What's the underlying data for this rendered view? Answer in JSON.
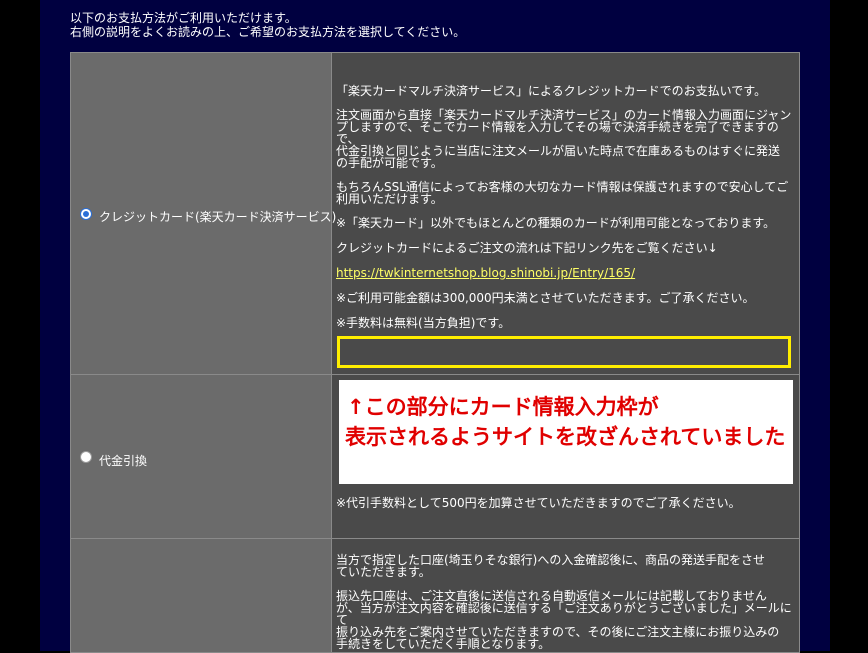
{
  "intro": {
    "line1": "以下のお支払方法がご利用いただけます。",
    "line2": "右側の説明をよくお読みの上、ご希望のお支払方法を選択してください。"
  },
  "options": [
    {
      "label": "クレジットカード(楽天カード決済サービス)",
      "selected": true,
      "desc": {
        "p1": "「楽天カードマルチ決済サービス」によるクレジットカードでのお支払いです。",
        "p2a": "注文画面から直接「楽天カードマルチ決済サービス」のカード情報入力画面にジャン",
        "p2b": "プしますので、そこでカード情報を入力してその場で決済手続きを完了できますので、",
        "p2c": "代金引換と同じように当店に注文メールが届いた時点で在庫あるものはすぐに発送",
        "p2d": "の手配が可能です。",
        "p3a": "もちろんSSL通信によってお客様の大切なカード情報は保護されますので安心してご",
        "p3b": "利用いただけます。",
        "p4": "※「楽天カード」以外でもほとんどの種類のカードが利用可能となっております。",
        "p5": "クレジットカードによるご注文の流れは下記リンク先をご覧ください↓",
        "link": "https://twkinternetshop.blog.shinobi.jp/Entry/165/",
        "p6": "※ご利用可能金額は300,000円未満とさせていただきます。ご了承ください。",
        "p7": "※手数料は無料(当方負担)です。"
      }
    },
    {
      "label": "代金引換",
      "selected": false,
      "desc": {
        "fee": "※代引手数料として500円を加算させていただきますのでご了承ください。"
      }
    },
    {
      "label": "",
      "selected": false,
      "desc": {
        "p1a": "当方で指定した口座(埼玉りそな銀行)への入金確認後に、商品の発送手配をさせ",
        "p1b": "ていただきます。",
        "p2a": "振込先口座は、ご注文直後に送信される自動返信メールには記載しておりません",
        "p2b": "が、当方が注文内容を確認後に送信する「ご注文ありがとうございました」メールにて",
        "p2c": "振り込み先をご案内させていただきますので、その後にご注文主様にお振り込みの",
        "p2d": "手続きをしていただく手順となります。"
      }
    }
  ],
  "annotation": {
    "line1": "↑この部分にカード情報入力枠が",
    "line2": "表示されるようサイトを改ざんされていました",
    "text_color": "#e00000",
    "highlight_color": "#ffee00"
  }
}
